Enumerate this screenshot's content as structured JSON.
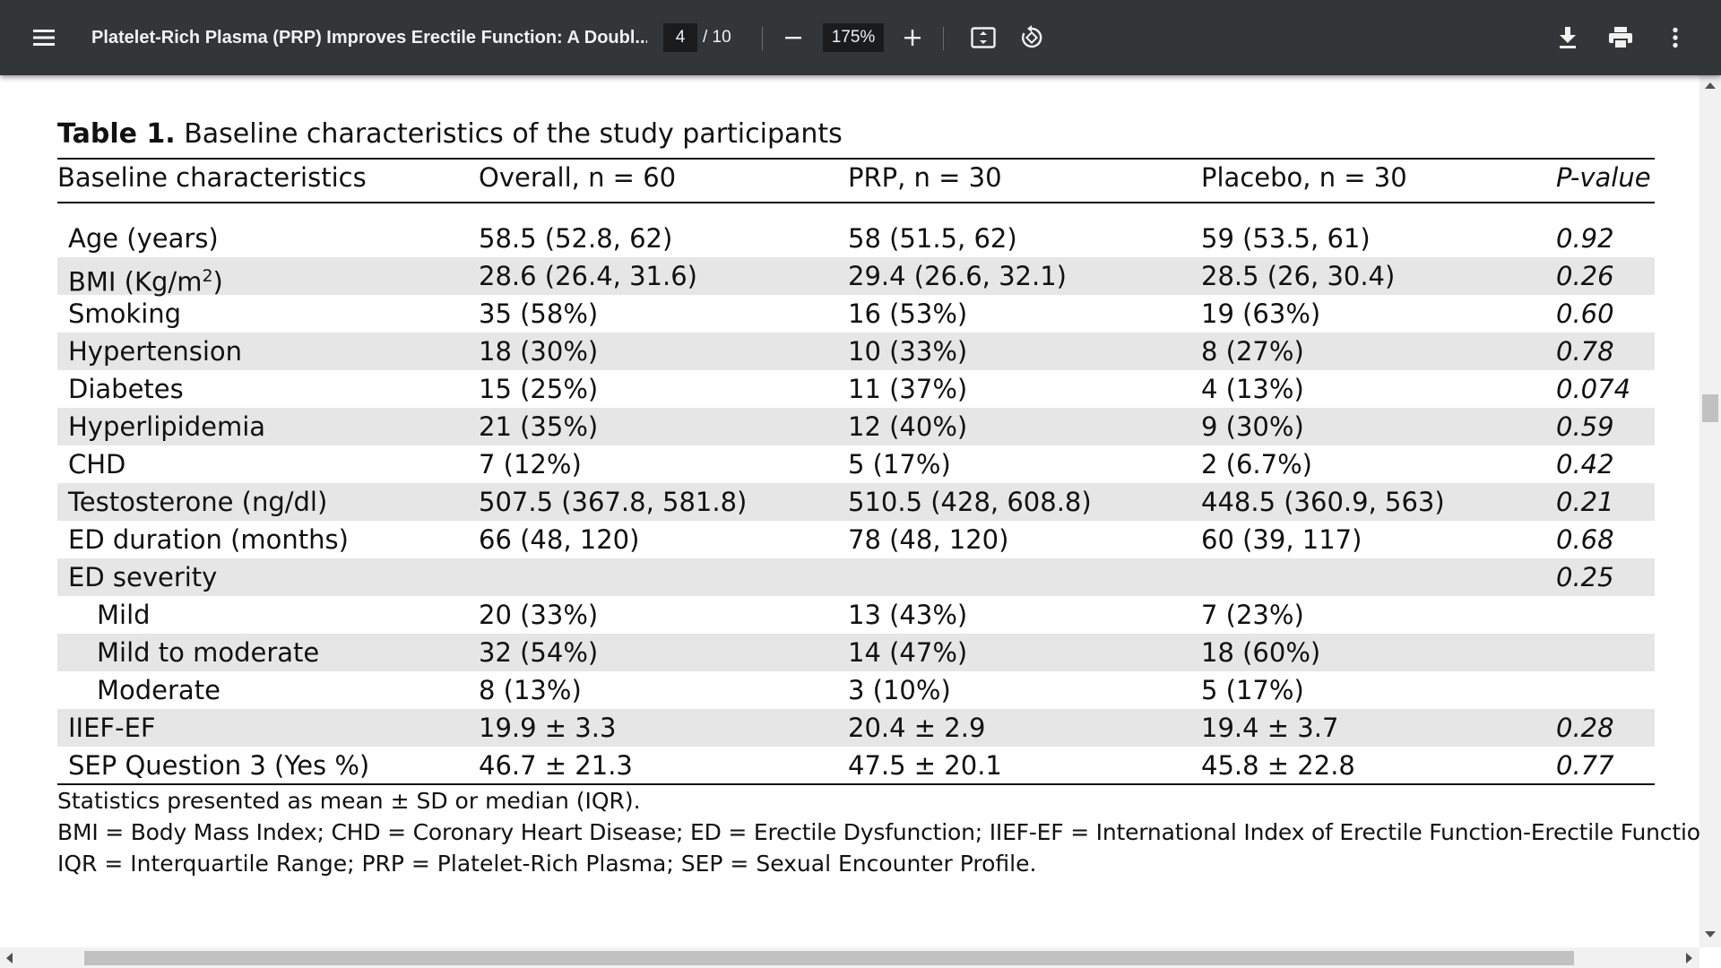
{
  "toolbar": {
    "title": "Platelet-Rich Plasma (PRP) Improves Erectile Function: A Doubl...",
    "page_current": "4",
    "page_total": "/ 10",
    "zoom": "175%",
    "icons": [
      "menu-icon",
      "zoom-out-icon",
      "zoom-in-icon",
      "fit-page-icon",
      "rotate-icon",
      "download-icon",
      "print-icon",
      "more-vert-icon"
    ]
  },
  "table": {
    "label": "Table 1.",
    "caption": " Baseline characteristics of the study participants",
    "headers": [
      "Baseline characteristics",
      "Overall, n = 60",
      "PRP, n = 30",
      "Placebo, n = 30",
      "P-value"
    ],
    "rows": [
      {
        "label": "Age (years)",
        "overall": "58.5 (52.8, 62)",
        "prp": "58 (51.5, 62)",
        "placebo": "59 (53.5, 61)",
        "p": "0.92"
      },
      {
        "label": "BMI (Kg/m",
        "sup": "2",
        "label_end": ")",
        "overall": "28.6 (26.4, 31.6)",
        "prp": "29.4 (26.6, 32.1)",
        "placebo": "28.5 (26, 30.4)",
        "p": "0.26"
      },
      {
        "label": "Smoking",
        "overall": "35 (58%)",
        "prp": "16 (53%)",
        "placebo": "19 (63%)",
        "p": "0.60"
      },
      {
        "label": "Hypertension",
        "overall": "18 (30%)",
        "prp": "10 (33%)",
        "placebo": "8 (27%)",
        "p": "0.78"
      },
      {
        "label": "Diabetes",
        "overall": "15 (25%)",
        "prp": "11 (37%)",
        "placebo": "4 (13%)",
        "p": "0.074"
      },
      {
        "label": "Hyperlipidemia",
        "overall": "21 (35%)",
        "prp": "12 (40%)",
        "placebo": "9 (30%)",
        "p": "0.59"
      },
      {
        "label": "CHD",
        "overall": "7 (12%)",
        "prp": "5 (17%)",
        "placebo": "2 (6.7%)",
        "p": "0.42"
      },
      {
        "label": "Testosterone (ng/dl)",
        "overall": "507.5 (367.8, 581.8)",
        "prp": "510.5 (428, 608.8)",
        "placebo": "448.5 (360.9, 563)",
        "p": "0.21"
      },
      {
        "label": "ED duration (months)",
        "overall": "66 (48, 120)",
        "prp": "78 (48, 120)",
        "placebo": "60 (39, 117)",
        "p": "0.68"
      },
      {
        "label": "ED severity",
        "overall": "",
        "prp": "",
        "placebo": "",
        "p": "0.25"
      },
      {
        "label": "Mild",
        "indent": true,
        "overall": "20 (33%)",
        "prp": "13 (43%)",
        "placebo": "7 (23%)",
        "p": ""
      },
      {
        "label": "Mild to moderate",
        "indent": true,
        "overall": "32 (54%)",
        "prp": "14 (47%)",
        "placebo": "18 (60%)",
        "p": ""
      },
      {
        "label": "Moderate",
        "indent": true,
        "overall": "8 (13%)",
        "prp": "3 (10%)",
        "placebo": "5 (17%)",
        "p": ""
      },
      {
        "label": "IIEF-EF",
        "overall": "19.9 ± 3.3",
        "prp": "20.4 ± 2.9",
        "placebo": "19.4 ± 3.7",
        "p": "0.28"
      },
      {
        "label": "SEP Question 3 (Yes %)",
        "overall": "46.7 ± 21.3",
        "prp": "47.5 ± 20.1",
        "placebo": "45.8 ± 22.8",
        "p": "0.77"
      }
    ],
    "notes": [
      "Statistics presented as mean ± SD or median (IQR).",
      "BMI = Body Mass Index; CHD = Coronary Heart Disease; ED = Erectile Dysfunction; IIEF-EF = International Index of Erectile Function-Erectile Function;",
      "IQR = Interquartile Range; PRP = Platelet-Rich Plasma; SEP = Sexual Encounter Profile."
    ]
  },
  "colors": {
    "toolbar_bg": "#323639",
    "row_shade": "#e6e6e6",
    "text": "#111111"
  }
}
